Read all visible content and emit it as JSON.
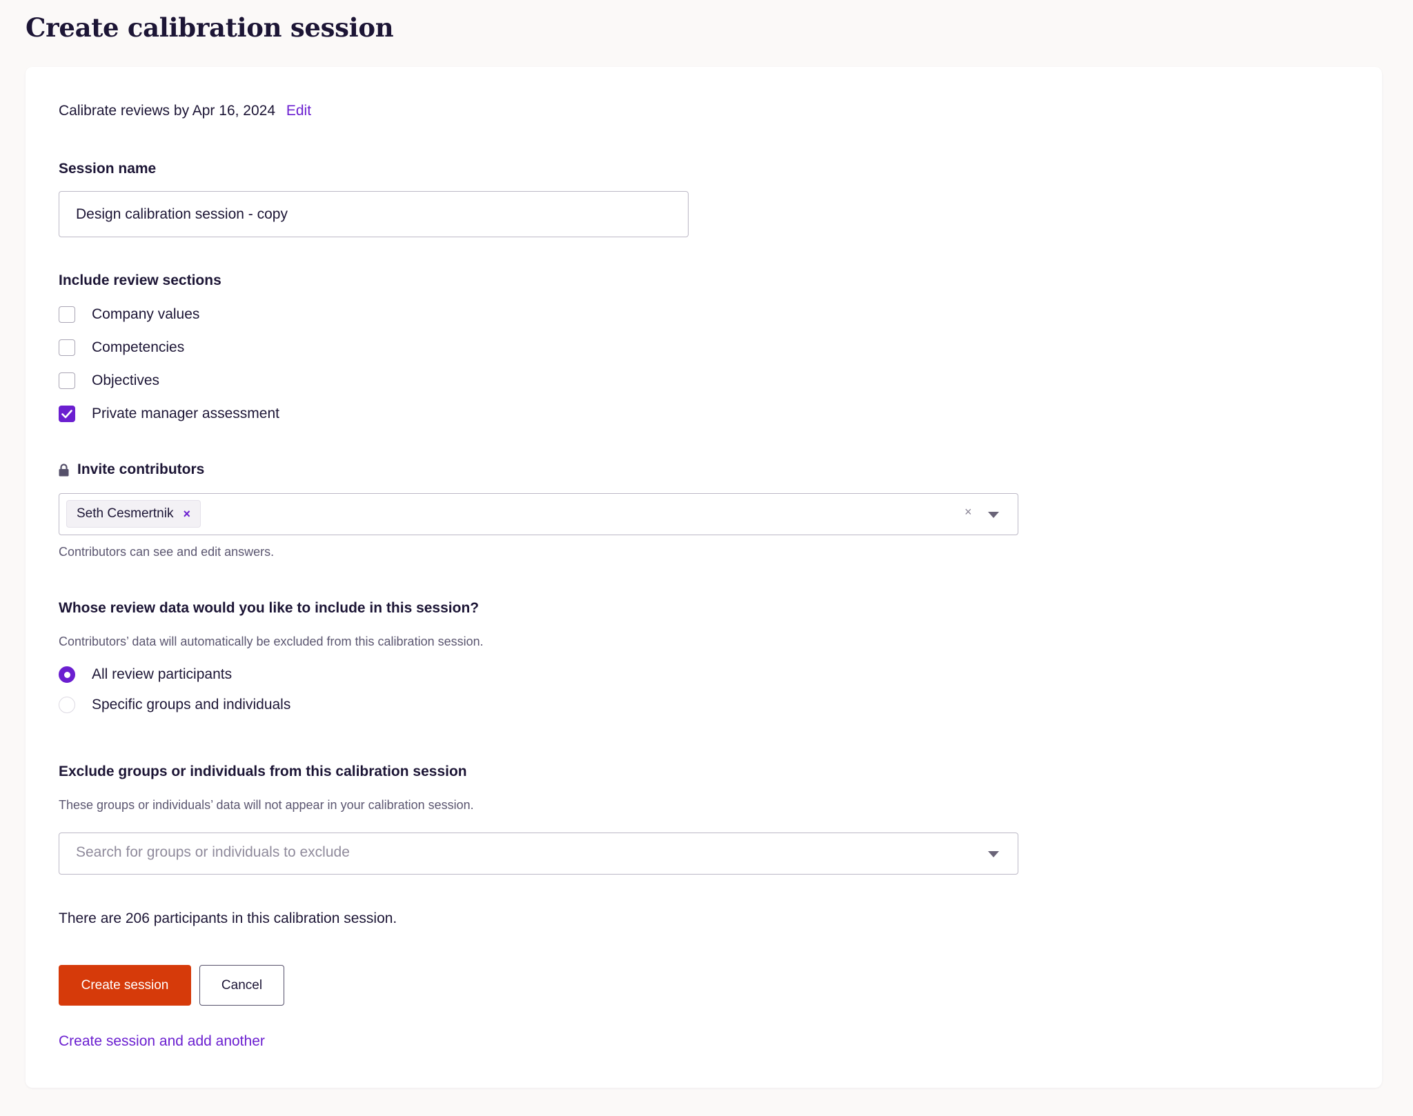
{
  "page": {
    "title": "Create calibration session"
  },
  "deadline": {
    "text": "Calibrate reviews by Apr 16, 2024",
    "edit_label": "Edit"
  },
  "session_name": {
    "label": "Session name",
    "value": "Design calibration session - copy"
  },
  "review_sections": {
    "label": "Include review sections",
    "items": [
      {
        "label": "Company values",
        "checked": false
      },
      {
        "label": "Competencies",
        "checked": false
      },
      {
        "label": "Objectives",
        "checked": false
      },
      {
        "label": "Private manager assessment",
        "checked": true
      }
    ]
  },
  "contributors": {
    "label": "Invite contributors",
    "lock_icon": "lock-icon",
    "selected": [
      {
        "name": "Seth Cesmertnik",
        "remove_symbol": "×"
      }
    ],
    "clear_symbol": "×",
    "help": "Contributors can see and edit answers."
  },
  "review_data": {
    "question": "Whose review data would you like to include in this session?",
    "help": "Contributors’ data will automatically be excluded from this calibration session.",
    "options": [
      {
        "label": "All review participants",
        "selected": true
      },
      {
        "label": "Specific groups and individuals",
        "selected": false
      }
    ]
  },
  "exclude": {
    "label": "Exclude groups or individuals from this calibration session",
    "help": "These groups or individuals’ data will not appear in your calibration session.",
    "placeholder": "Search for groups or individuals to exclude"
  },
  "participants": {
    "text": "There are 206 participants in this calibration session."
  },
  "actions": {
    "create_label": "Create session",
    "cancel_label": "Cancel",
    "create_and_add_label": "Create session and add another"
  },
  "colors": {
    "accent": "#6b1fd0",
    "primary_button": "#d63a0a",
    "text": "#1c1535",
    "background": "#fbf9f8"
  }
}
